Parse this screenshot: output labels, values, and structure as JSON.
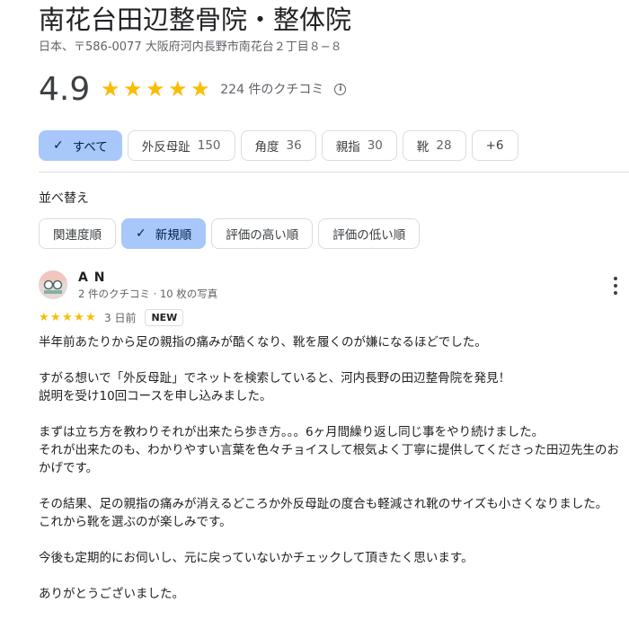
{
  "business": {
    "name": "南花台田辺整骨院・整体院",
    "address": "日本、〒586-0077 大阪府河内長野市南花台２丁目８−８"
  },
  "rating": {
    "value": "4.9",
    "stars": "★★★★★",
    "review_count": "224 件のクチコミ",
    "info_icon": "i"
  },
  "topics": [
    {
      "label": "すべて",
      "count": "",
      "selected": true
    },
    {
      "label": "外反母趾",
      "count": "150"
    },
    {
      "label": "角度",
      "count": "36"
    },
    {
      "label": "親指",
      "count": "30"
    },
    {
      "label": "靴",
      "count": "28"
    },
    {
      "label": "+6",
      "count": ""
    }
  ],
  "sort": {
    "label": "並べ替え",
    "options": [
      {
        "label": "関連度順"
      },
      {
        "label": "新規順",
        "selected": true
      },
      {
        "label": "評価の高い順"
      },
      {
        "label": "評価の低い順"
      }
    ]
  },
  "icons": {
    "check": "✓",
    "more": "more-vert-icon",
    "info": "info-icon"
  },
  "colors": {
    "star": "#fbbc04",
    "selected_chip": "#a8c7fa"
  },
  "review": {
    "author": "A N",
    "meta": "2 件のクチコミ · 10 枚の写真",
    "stars": "★★★★★",
    "date": "3 日前",
    "badge": "NEW",
    "paragraphs": [
      "半年前あたりから足の親指の痛みが酷くなり、靴を履くのが嫌になるほどでした。",
      "",
      "すがる想いで「外反母趾」でネットを検索していると、河内長野の田辺整骨院を発見！",
      "説明を受け10回コースを申し込みました。",
      "",
      "まずは立ち方を教わりそれが出来たら歩き方。。。6ヶ月間繰り返し同じ事をやり続けました。",
      "それが出来たのも、わかりやすい言葉を色々チョイスして根気よく丁寧に提供してくださった田辺先生のおかげです。",
      "",
      "その結果、足の親指の痛みが消えるどころか外反母趾の度合も軽減され靴のサイズも小さくなりました。",
      "これから靴を選ぶのが楽しみです。",
      "",
      "今後も定期的にお伺いし、元に戻っていないかチェックして頂きたく思います。",
      "",
      "ありがとうございました。"
    ]
  }
}
